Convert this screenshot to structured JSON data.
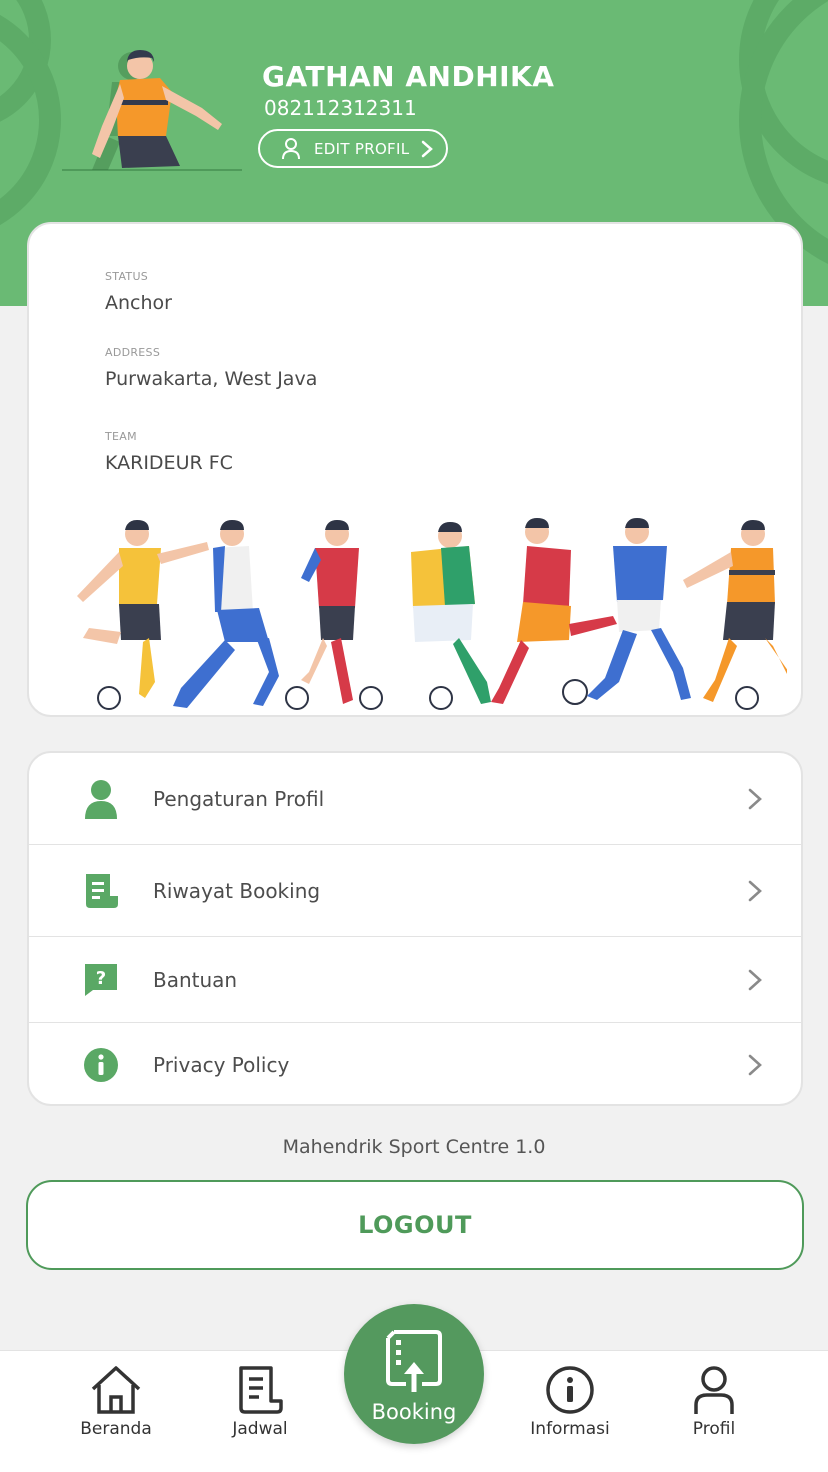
{
  "profile": {
    "name": "GATHAN ANDHIKA",
    "phone": "082112312311",
    "edit_label": "EDIT PROFIL"
  },
  "info": {
    "status_label": "STATUS",
    "status_value": "Anchor",
    "address_label": "ADDRESS",
    "address_value": "Purwakarta, West Java",
    "team_label": "TEAM",
    "team_value": "KARIDEUR FC"
  },
  "menu": {
    "items": [
      {
        "label": "Pengaturan Profil",
        "icon": "person-icon"
      },
      {
        "label": "Riwayat Booking",
        "icon": "document-icon"
      },
      {
        "label": "Bantuan",
        "icon": "help-chat-icon"
      },
      {
        "label": "Privacy Policy",
        "icon": "info-icon"
      }
    ]
  },
  "version": "Mahendrik Sport Centre 1.0",
  "logout_label": "LOGOUT",
  "nav": {
    "items": [
      {
        "label": "Beranda",
        "icon": "home-icon"
      },
      {
        "label": "Jadwal",
        "icon": "schedule-icon"
      },
      {
        "label": "Booking",
        "icon": "booking-icon"
      },
      {
        "label": "Informasi",
        "icon": "info-icon"
      },
      {
        "label": "Profil",
        "icon": "user-icon"
      }
    ]
  },
  "colors": {
    "primary": "#6aba74",
    "primary_dark": "#54995e",
    "icon_green": "#5aa865",
    "background": "#f1f1f1"
  }
}
